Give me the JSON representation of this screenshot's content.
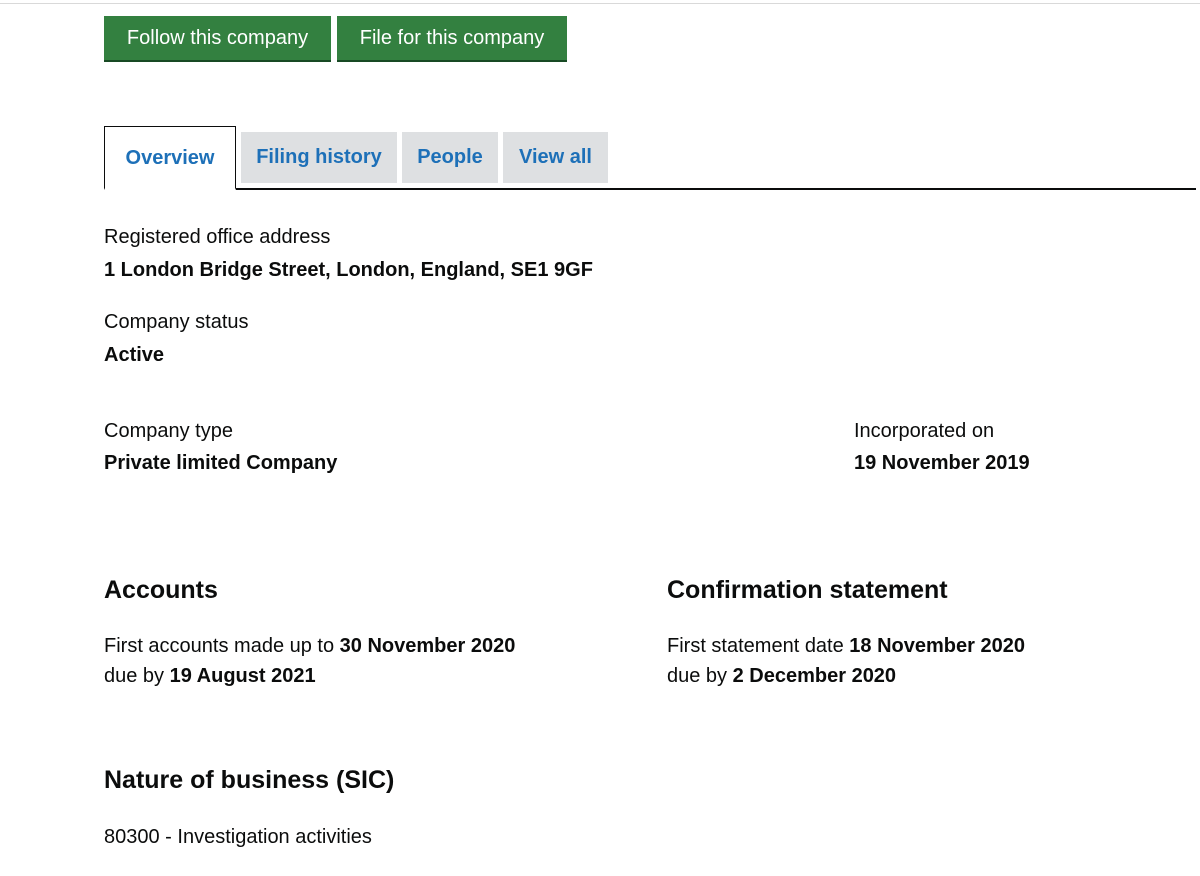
{
  "actions": {
    "follow_label": "Follow this company",
    "file_label": "File for this company"
  },
  "tabs": [
    {
      "label": "Overview",
      "active": true
    },
    {
      "label": "Filing history",
      "active": false
    },
    {
      "label": "People",
      "active": false
    },
    {
      "label": "View all",
      "active": false
    }
  ],
  "overview": {
    "registered_office": {
      "label": "Registered office address",
      "value": "1 London Bridge Street, London, England, SE1 9GF"
    },
    "status": {
      "label": "Company status",
      "value": "Active"
    },
    "type": {
      "label": "Company type",
      "value": "Private limited Company"
    },
    "incorporated": {
      "label": "Incorporated on",
      "value": "19 November 2019"
    }
  },
  "accounts": {
    "heading": "Accounts",
    "line1_prefix": "First accounts made up to ",
    "line1_value": "30 November 2020",
    "line2_prefix": "due by ",
    "line2_value": "19 August 2021"
  },
  "confirmation": {
    "heading": "Confirmation statement",
    "line1_prefix": "First statement date ",
    "line1_value": "18 November 2020",
    "line2_prefix": "due by ",
    "line2_value": "2 December 2020"
  },
  "sic": {
    "heading": "Nature of business (SIC)",
    "items": [
      "80300 - Investigation activities"
    ]
  },
  "colors": {
    "button_green": "#338040",
    "link_blue": "#1d70b8",
    "tab_grey": "#dee0e2",
    "text": "#0b0c0c"
  }
}
